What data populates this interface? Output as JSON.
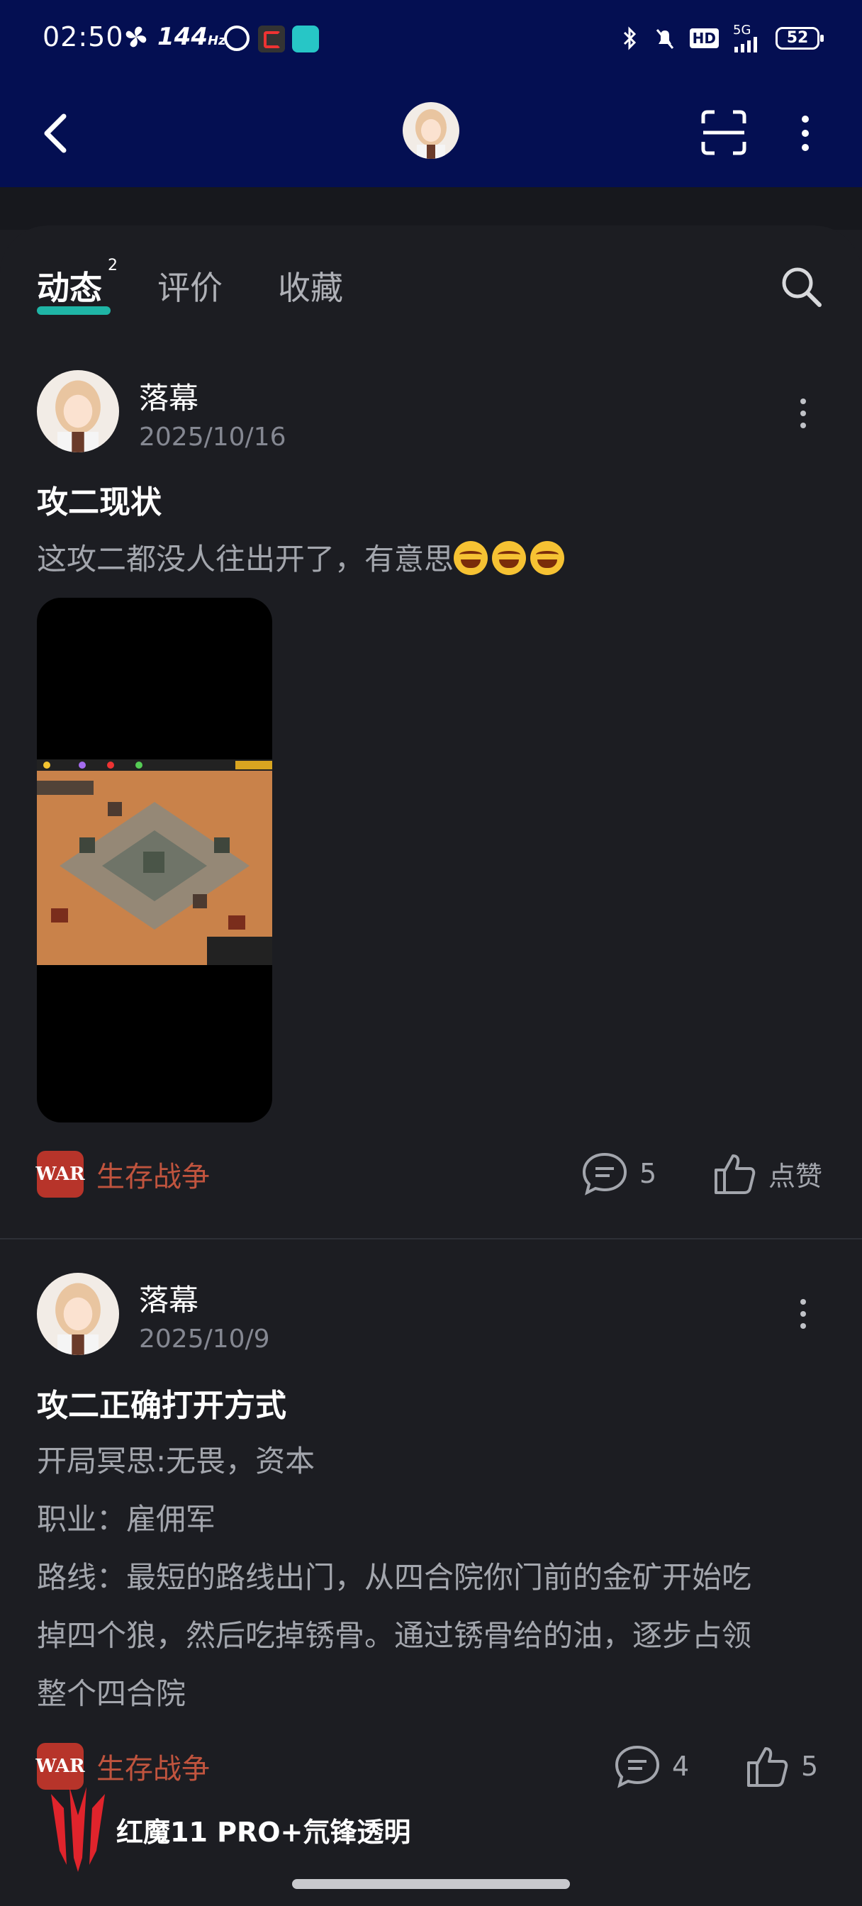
{
  "status_bar": {
    "time": "02:50",
    "refresh_rate": "144",
    "refresh_unit": "Hz",
    "network": "5G",
    "battery": "52",
    "hd_label": "HD"
  },
  "tabs": [
    {
      "label": "动态",
      "badge": "2",
      "active": true
    },
    {
      "label": "评价",
      "active": false
    },
    {
      "label": "收藏",
      "active": false
    }
  ],
  "posts": [
    {
      "author": "落幕",
      "date": "2025/10/16",
      "title": "攻二现状",
      "body": "这攻二都没人往出开了，有意思",
      "emoji_count": 3,
      "game": "生存战争",
      "game_logo": "WAR",
      "comments": "5",
      "like_label": "点赞"
    },
    {
      "author": "落幕",
      "date": "2025/10/9",
      "title": "攻二正确打开方式",
      "lines": [
        "开局冥思:无畏，资本",
        "职业：雇佣军",
        "路线：最短的路线出门，从四合院你门前的金矿开始吃",
        "掉四个狼，然后吃掉锈骨。通过锈骨给的油，逐步占领",
        "整个四合院"
      ],
      "game": "生存战争",
      "game_logo": "WAR",
      "comments": "4",
      "likes": "5"
    }
  ],
  "watermark": {
    "text": "红魔11 PRO+氘锋透明"
  },
  "colors": {
    "header": "#040f52",
    "background": "#1c1d22",
    "accent": "#1fb5a6",
    "game_name": "#c0543e"
  }
}
